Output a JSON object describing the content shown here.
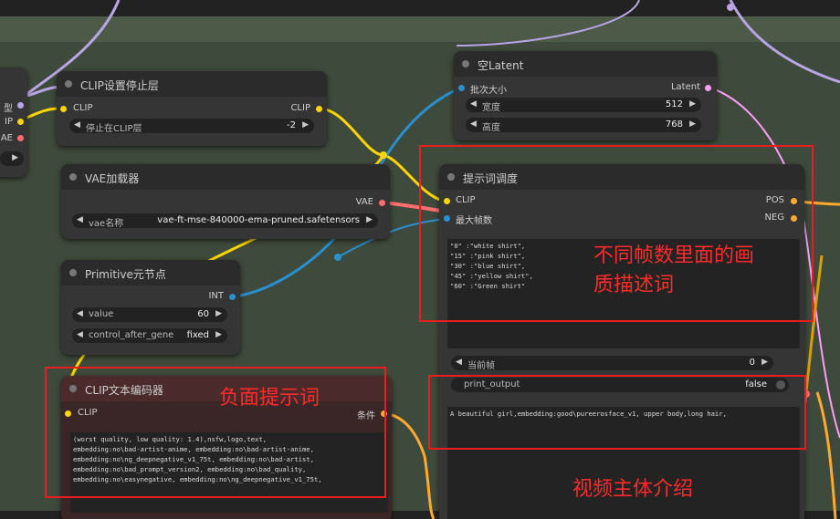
{
  "nodes": {
    "left_partial": {
      "ports": [
        "型",
        "IP",
        "AE"
      ]
    },
    "clip_set_last_layer": {
      "title": "CLIP设置停止层",
      "input": "CLIP",
      "output": "CLIP",
      "widget_label": "停止在CLIP层",
      "widget_value": "-2"
    },
    "vae_loader": {
      "title": "VAE加载器",
      "output": "VAE",
      "widget_label": "vae名称",
      "widget_value": "vae-ft-mse-840000-ema-pruned.safetensors"
    },
    "primitive": {
      "title": "Primitive元节点",
      "output": "INT",
      "value_label": "value",
      "value": "60",
      "control_label": "control_after_gene",
      "control_value": "fixed"
    },
    "clip_text_encoder": {
      "title": "CLIP文本编码器",
      "input": "CLIP",
      "output": "条件",
      "text": "(worst quality, low quality: 1.4),nsfw,logo,text,\nembedding:no\\bad-artist-anime, embedding:no\\bad-artist-anime,\nembedding:no\\ng_deepnegative_v1_75t, embedding:no\\bad-artist,\nembedding:no\\bad_prompt_version2, embedding:no\\bad_quality,\nembedding:no\\easynegative, embedding:no\\ng_deepnegative_v1_75t,"
    },
    "empty_latent": {
      "title": "空Latent",
      "input": "批次大小",
      "output": "Latent",
      "width_label": "宽度",
      "width_value": "512",
      "height_label": "高度",
      "height_value": "768"
    },
    "prompt_schedule": {
      "title": "提示词调度",
      "input_clip": "CLIP",
      "input_max_frames": "最大帧数",
      "output_pos": "POS",
      "output_neg": "NEG",
      "text": "\"0\" :\"white shirt\",\n\"15\" :\"pink shirt\",\n\"30\" :\"blue shirt\",\n\"45\" :\"yellow shirt\",\n\"60\" :\"Green shirt\"",
      "current_frame_label": "当前帧",
      "current_frame_value": "0",
      "print_output_label": "print_output",
      "print_output_value": "false",
      "pre_text": "A beautiful girl,embedding:good\\pureerosface_v1, upper body,long hair,"
    }
  },
  "annotations": {
    "frames_quality": "不同帧数里面的画\n质描述词",
    "negative": "负面提示词",
    "subject": "视频主体介绍",
    "color": "#ff2a2a"
  },
  "colors": {
    "clip": "#ffd500",
    "vae": "#ff6e6e",
    "int": "#2a8fcf",
    "latent": "#ff9cf9",
    "conditioning": "#ffa931"
  }
}
